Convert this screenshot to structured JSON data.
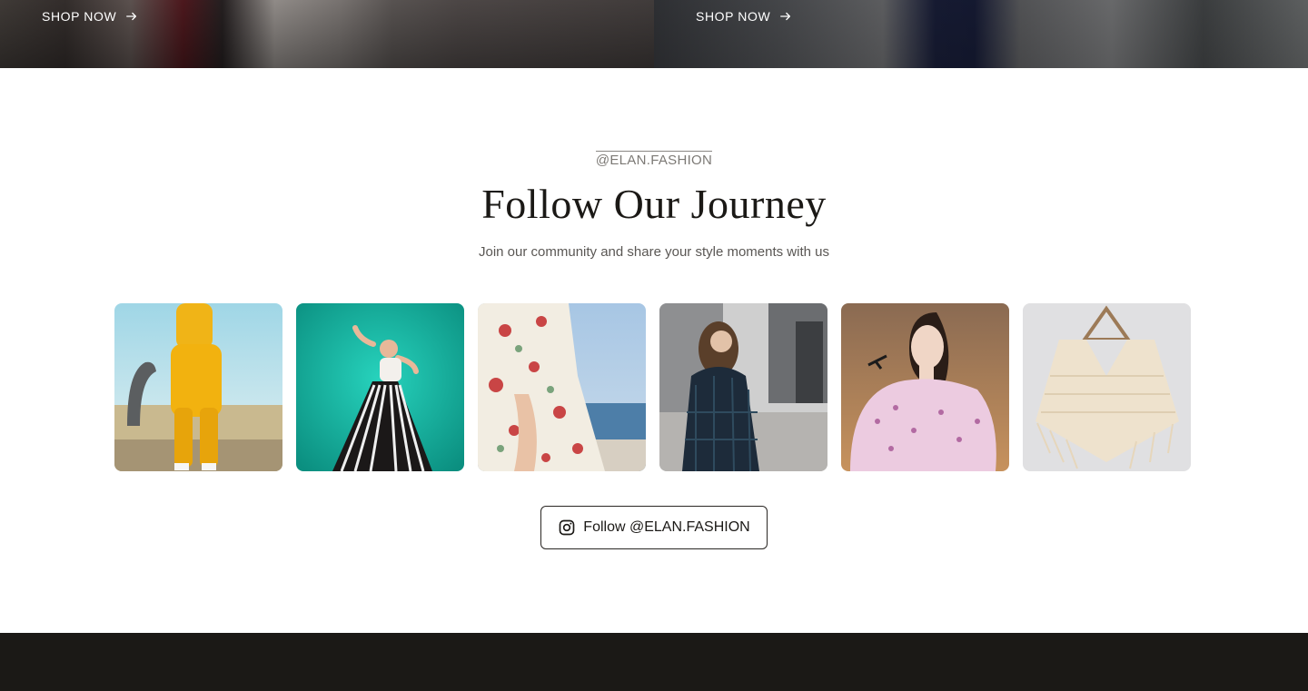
{
  "banners": [
    {
      "shop_label": "SHOP NOW",
      "icon": "arrow-right-icon"
    },
    {
      "shop_label": "SHOP NOW",
      "icon": "arrow-right-icon"
    }
  ],
  "follow_section": {
    "handle": "@ELAN.FASHION",
    "title": "Follow Our Journey",
    "subtitle": "Join our community and share your style moments with us",
    "button_label": "Follow @ELAN.FASHION",
    "button_icon": "instagram-icon"
  },
  "gallery": [
    {
      "name": "gallery-photo-yellow-tracksuit"
    },
    {
      "name": "gallery-photo-striped-pants-teal"
    },
    {
      "name": "gallery-photo-floral-dress"
    },
    {
      "name": "gallery-photo-plaid-coat"
    },
    {
      "name": "gallery-photo-pink-ruffle-blouse"
    },
    {
      "name": "gallery-photo-knit-poncho"
    }
  ],
  "colors": {
    "text_dark": "#1b1916",
    "text_muted": "#5a5754",
    "footer_bg": "#1b1916",
    "background": "#ffffff"
  }
}
